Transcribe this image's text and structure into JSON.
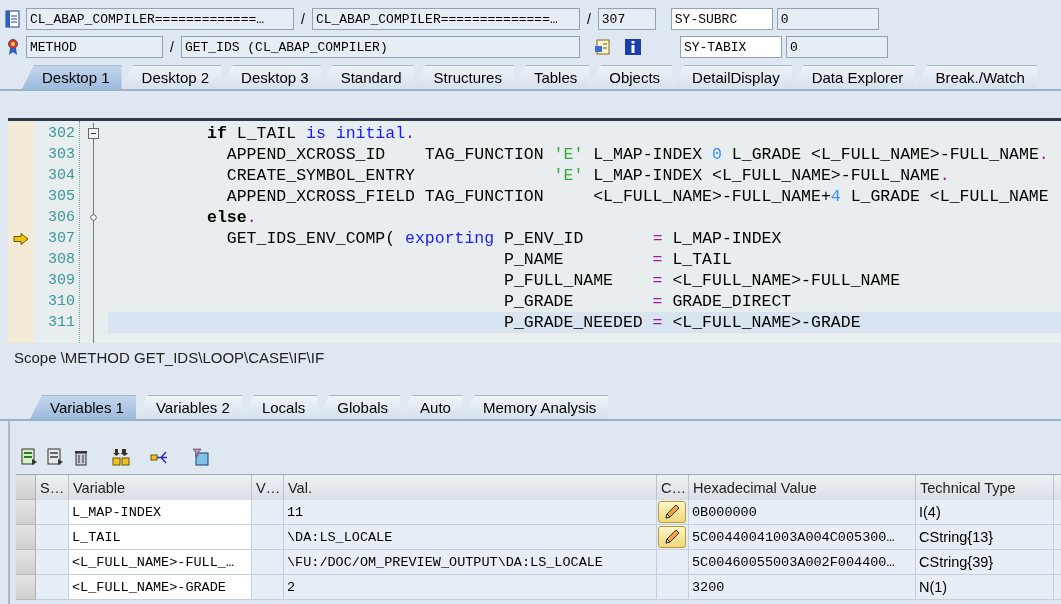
{
  "program_row": {
    "include": "CL_ABAP_COMPILER=============…",
    "separator_1": "/",
    "program": "CL_ABAP_COMPILER==============…",
    "separator_2": "/",
    "line": "307"
  },
  "event_row": {
    "type": "METHOD",
    "separator": "/",
    "name": "GET_IDS (CL_ABAP_COMPILER)"
  },
  "system_fields": [
    {
      "name": "SY-SUBRC",
      "value": "0"
    },
    {
      "name": "SY-TABIX",
      "value": "0"
    }
  ],
  "desktop_tabs": [
    {
      "label": "Desktop 1",
      "selected": true
    },
    {
      "label": "Desktop 2",
      "selected": false
    },
    {
      "label": "Desktop 3",
      "selected": false
    },
    {
      "label": "Standard",
      "selected": false
    },
    {
      "label": "Structures",
      "selected": false
    },
    {
      "label": "Tables",
      "selected": false
    },
    {
      "label": "Objects",
      "selected": false
    },
    {
      "label": "DetailDisplay",
      "selected": false
    },
    {
      "label": "Data Explorer",
      "selected": false
    },
    {
      "label": "Break./Watch",
      "selected": false
    }
  ],
  "editor": {
    "lines": [
      {
        "number": "302",
        "current": false,
        "highlighted": false,
        "fold_toggle": true,
        "fold_branch": false,
        "tokens": [
          {
            "kind": "keyword",
            "text": "          if"
          },
          {
            "kind": "plain",
            "text": " L_TAIL "
          },
          {
            "kind": "blue",
            "text": "is initial"
          },
          {
            "kind": "op",
            "text": "."
          }
        ]
      },
      {
        "number": "303",
        "current": false,
        "highlighted": false,
        "fold_toggle": false,
        "fold_branch": false,
        "tokens": [
          {
            "kind": "plain",
            "text": "            APPEND_XCROSS_ID    TAG_FUNCTION "
          },
          {
            "kind": "string",
            "text": "'E'"
          },
          {
            "kind": "plain",
            "text": " L_MAP-INDEX "
          },
          {
            "kind": "number",
            "text": "0"
          },
          {
            "kind": "plain",
            "text": " L_GRADE <L_FULL_NAME>-FULL_NAME"
          },
          {
            "kind": "op",
            "text": "."
          }
        ]
      },
      {
        "number": "304",
        "current": false,
        "highlighted": false,
        "fold_toggle": false,
        "fold_branch": false,
        "tokens": [
          {
            "kind": "plain",
            "text": "            CREATE_SYMBOL_ENTRY              "
          },
          {
            "kind": "string",
            "text": "'E'"
          },
          {
            "kind": "plain",
            "text": " L_MAP-INDEX <L_FULL_NAME>-FULL_NAME"
          },
          {
            "kind": "op",
            "text": "."
          }
        ]
      },
      {
        "number": "305",
        "current": false,
        "highlighted": false,
        "fold_toggle": false,
        "fold_branch": false,
        "tokens": [
          {
            "kind": "plain",
            "text": "            APPEND_XCROSS_FIELD TAG_FUNCTION     <L_FULL_NAME>-FULL_NAME+"
          },
          {
            "kind": "number",
            "text": "4"
          },
          {
            "kind": "plain",
            "text": " L_GRADE <L_FULL_NAME"
          }
        ]
      },
      {
        "number": "306",
        "current": false,
        "highlighted": false,
        "fold_toggle": false,
        "fold_branch": true,
        "tokens": [
          {
            "kind": "keyword",
            "text": "          else"
          },
          {
            "kind": "op",
            "text": "."
          }
        ]
      },
      {
        "number": "307",
        "current": true,
        "highlighted": false,
        "fold_toggle": false,
        "fold_branch": false,
        "tokens": [
          {
            "kind": "plain",
            "text": "            GET_IDS_ENV_COMP( "
          },
          {
            "kind": "blue",
            "text": "exporting"
          },
          {
            "kind": "plain",
            "text": " P_ENV_ID       "
          },
          {
            "kind": "op",
            "text": "="
          },
          {
            "kind": "plain",
            "text": " L_MAP-INDEX"
          }
        ]
      },
      {
        "number": "308",
        "current": false,
        "highlighted": false,
        "fold_toggle": false,
        "fold_branch": false,
        "tokens": [
          {
            "kind": "plain",
            "text": "                                        P_NAME         "
          },
          {
            "kind": "op",
            "text": "="
          },
          {
            "kind": "plain",
            "text": " L_TAIL"
          }
        ]
      },
      {
        "number": "309",
        "current": false,
        "highlighted": false,
        "fold_toggle": false,
        "fold_branch": false,
        "tokens": [
          {
            "kind": "plain",
            "text": "                                        P_FULL_NAME    "
          },
          {
            "kind": "op",
            "text": "="
          },
          {
            "kind": "plain",
            "text": " <L_FULL_NAME>-FULL_NAME"
          }
        ]
      },
      {
        "number": "310",
        "current": false,
        "highlighted": false,
        "fold_toggle": false,
        "fold_branch": false,
        "tokens": [
          {
            "kind": "plain",
            "text": "                                        P_GRADE        "
          },
          {
            "kind": "op",
            "text": "="
          },
          {
            "kind": "plain",
            "text": " GRADE_DIRECT"
          }
        ]
      },
      {
        "number": "311",
        "current": false,
        "highlighted": true,
        "fold_toggle": false,
        "fold_branch": false,
        "tokens": [
          {
            "kind": "plain",
            "text": "                                        P_GRADE_NEEDED "
          },
          {
            "kind": "op",
            "text": "="
          },
          {
            "kind": "plain",
            "text": " <L_FULL_NAME>-GRADE"
          }
        ]
      }
    ]
  },
  "scope": "Scope \\METHOD GET_IDS\\LOOP\\CASE\\IF\\IF",
  "variable_tabs": [
    {
      "label": "Variables 1",
      "selected": true
    },
    {
      "label": "Variables 2",
      "selected": false
    },
    {
      "label": "Locals",
      "selected": false
    },
    {
      "label": "Globals",
      "selected": false
    },
    {
      "label": "Auto",
      "selected": false
    },
    {
      "label": "Memory Analysis",
      "selected": false
    }
  ],
  "table": {
    "columns": [
      "S…",
      "Variable",
      "V…",
      "Val.",
      "C…",
      "Hexadecimal Value",
      "Technical Type"
    ],
    "rows": [
      {
        "variable": "L_MAP-INDEX",
        "value": "11",
        "editable": true,
        "hex": "0B000000",
        "type": "I(4)"
      },
      {
        "variable": "L_TAIL",
        "value": "\\DA:LS_LOCALE",
        "editable": true,
        "hex": "5C00440041003A004C005300…",
        "type": "CString{13}"
      },
      {
        "variable": "<L_FULL_NAME>-FULL_…",
        "value": "\\FU:/DOC/OM_PREVIEW_OUTPUT\\DA:LS_LOCALE",
        "editable": false,
        "hex": "5C00460055003A002F004400…",
        "type": "CString{39}"
      },
      {
        "variable": "<L_FULL_NAME>-GRADE",
        "value": "2",
        "editable": false,
        "hex": "3200",
        "type": "N(1)"
      }
    ]
  }
}
